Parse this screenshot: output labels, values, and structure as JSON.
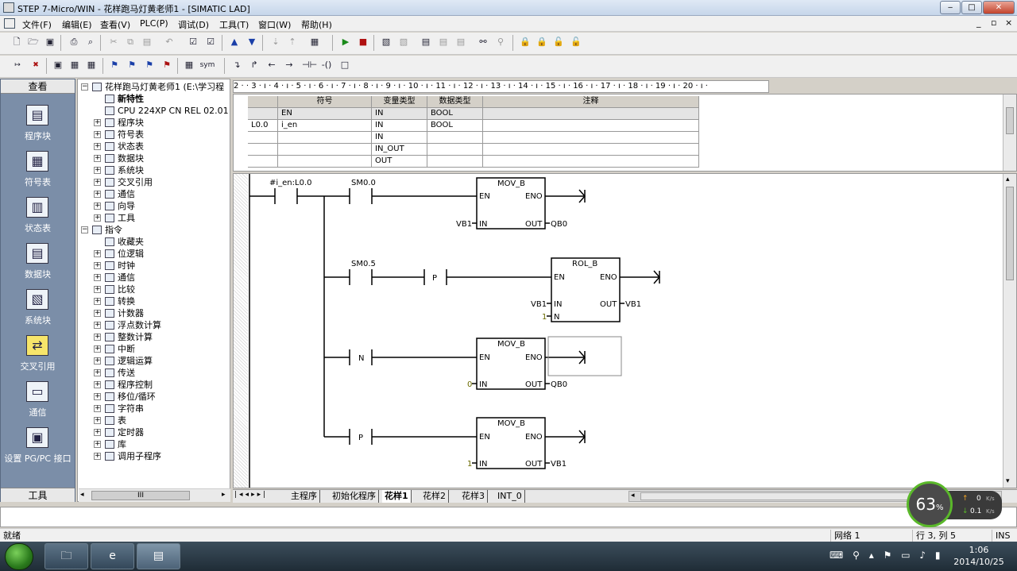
{
  "window": {
    "title": "STEP 7-Micro/WIN - 花样跑马灯黄老师1 - [SIMATIC LAD]",
    "min_label": "‒",
    "max_label": "□",
    "close_label": "✕"
  },
  "menu": [
    {
      "label": "文件(F)"
    },
    {
      "label": "编辑(E)"
    },
    {
      "label": "查看(V)"
    },
    {
      "label": "PLC(P)"
    },
    {
      "label": "调试(D)"
    },
    {
      "label": "工具(T)"
    },
    {
      "label": "窗口(W)"
    },
    {
      "label": "帮助(H)"
    }
  ],
  "mdi_controls": {
    "min": "_",
    "restore": "▫",
    "close": "×"
  },
  "nav": {
    "header": "查看",
    "footer": "工具",
    "items": [
      {
        "label": "程序块",
        "icon": "program-block-icon"
      },
      {
        "label": "符号表",
        "icon": "symbol-table-icon"
      },
      {
        "label": "状态表",
        "icon": "status-table-icon"
      },
      {
        "label": "数据块",
        "icon": "data-block-icon"
      },
      {
        "label": "系统块",
        "icon": "system-block-icon"
      },
      {
        "label": "交叉引用",
        "icon": "cross-reference-icon"
      },
      {
        "label": "通信",
        "icon": "communication-icon"
      },
      {
        "label": "设置 PG/PC 接口",
        "icon": "pgpc-interface-icon"
      }
    ]
  },
  "tree": {
    "items": [
      {
        "label": "花样跑马灯黄老师1 (E:\\学习程",
        "level": 0,
        "expander": "−"
      },
      {
        "label": "新特性",
        "level": 1,
        "expander": "",
        "bold": true
      },
      {
        "label": "CPU 224XP CN REL 02.01",
        "level": 1,
        "expander": ""
      },
      {
        "label": "程序块",
        "level": 1,
        "expander": "+"
      },
      {
        "label": "符号表",
        "level": 1,
        "expander": "+"
      },
      {
        "label": "状态表",
        "level": 1,
        "expander": "+"
      },
      {
        "label": "数据块",
        "level": 1,
        "expander": "+"
      },
      {
        "label": "系统块",
        "level": 1,
        "expander": "+"
      },
      {
        "label": "交叉引用",
        "level": 1,
        "expander": "+"
      },
      {
        "label": "通信",
        "level": 1,
        "expander": "+"
      },
      {
        "label": "向导",
        "level": 1,
        "expander": "+"
      },
      {
        "label": "工具",
        "level": 1,
        "expander": "+"
      },
      {
        "label": "指令",
        "level": 0,
        "expander": "−"
      },
      {
        "label": "收藏夹",
        "level": 1,
        "expander": ""
      },
      {
        "label": "位逻辑",
        "level": 1,
        "expander": "+"
      },
      {
        "label": "时钟",
        "level": 1,
        "expander": "+"
      },
      {
        "label": "通信",
        "level": 1,
        "expander": "+"
      },
      {
        "label": "比较",
        "level": 1,
        "expander": "+"
      },
      {
        "label": "转换",
        "level": 1,
        "expander": "+"
      },
      {
        "label": "计数器",
        "level": 1,
        "expander": "+"
      },
      {
        "label": "浮点数计算",
        "level": 1,
        "expander": "+"
      },
      {
        "label": "整数计算",
        "level": 1,
        "expander": "+"
      },
      {
        "label": "中断",
        "level": 1,
        "expander": "+"
      },
      {
        "label": "逻辑运算",
        "level": 1,
        "expander": "+"
      },
      {
        "label": "传送",
        "level": 1,
        "expander": "+"
      },
      {
        "label": "程序控制",
        "level": 1,
        "expander": "+"
      },
      {
        "label": "移位/循环",
        "level": 1,
        "expander": "+"
      },
      {
        "label": "字符串",
        "level": 1,
        "expander": "+"
      },
      {
        "label": "表",
        "level": 1,
        "expander": "+"
      },
      {
        "label": "定时器",
        "level": 1,
        "expander": "+"
      },
      {
        "label": "库",
        "level": 1,
        "expander": "+"
      },
      {
        "label": "调用子程序",
        "level": 1,
        "expander": "+"
      }
    ],
    "hscroll_label": "III"
  },
  "ruler": {
    "text": "2 · · 3 · ı · 4 · ı · 5 · ı · 6 · ı · 7 · ı · 8 · ı · 9 · ı · 10 · ı · 11 · ı · 12 · ı · 13 · ı · 14 · ı · 15 · ı · 16 · ı · 17 · ı · 18 · ı · 19 · ı · 20 · ı ·"
  },
  "var_table": {
    "headers": [
      "",
      "符号",
      "变量类型",
      "数据类型",
      "注释"
    ],
    "rows": [
      [
        "",
        "EN",
        "IN",
        "BOOL",
        ""
      ],
      [
        "L0.0",
        "i_en",
        "IN",
        "BOOL",
        ""
      ],
      [
        "",
        "",
        "IN",
        "",
        ""
      ],
      [
        "",
        "",
        "IN_OUT",
        "",
        ""
      ],
      [
        "",
        "",
        "OUT",
        "",
        ""
      ]
    ]
  },
  "ladder": {
    "contact1_label": "#i_en:L0.0",
    "contact2_label": "SM0.0",
    "contact3_label": "SM0.5",
    "p_label": "P",
    "n_label": "N",
    "box1": {
      "title": "MOV_B",
      "en": "EN",
      "eno": "ENO",
      "in_pin": "IN",
      "out_pin": "OUT",
      "in_val": "VB1",
      "out_val": "QB0"
    },
    "box2": {
      "title": "ROL_B",
      "en": "EN",
      "eno": "ENO",
      "in_pin": "IN",
      "out_pin": "OUT",
      "n_pin": "N",
      "in_val": "VB1",
      "out_val": "VB1",
      "n_val": "1"
    },
    "box3": {
      "title": "MOV_B",
      "en": "EN",
      "eno": "ENO",
      "in_pin": "IN",
      "out_pin": "OUT",
      "in_val": "0",
      "out_val": "QB0"
    },
    "box4": {
      "title": "MOV_B",
      "en": "EN",
      "eno": "ENO",
      "in_pin": "IN",
      "out_pin": "OUT",
      "in_val": "1",
      "out_val": "VB1"
    }
  },
  "tabs": [
    {
      "label": "主程序",
      "active": false
    },
    {
      "label": "初始化程序",
      "active": false
    },
    {
      "label": "花样1",
      "active": true
    },
    {
      "label": "花样2",
      "active": false
    },
    {
      "label": "花样3",
      "active": false
    },
    {
      "label": "INT_0",
      "active": false
    }
  ],
  "status": {
    "ready": "就绪",
    "network": "网络 1",
    "position": "行 3, 列 5",
    "mode": "INS"
  },
  "net_widget": {
    "percent": "63",
    "percent_sign": "%",
    "up": "0",
    "down": "0.1",
    "unit": "K/s"
  },
  "clock": {
    "time": "1:06",
    "date": "2014/10/25"
  },
  "colors": {
    "accent": "#5ab82a",
    "nav_bg": "#7b8ea8",
    "titlebar": "#c6d6ea"
  }
}
